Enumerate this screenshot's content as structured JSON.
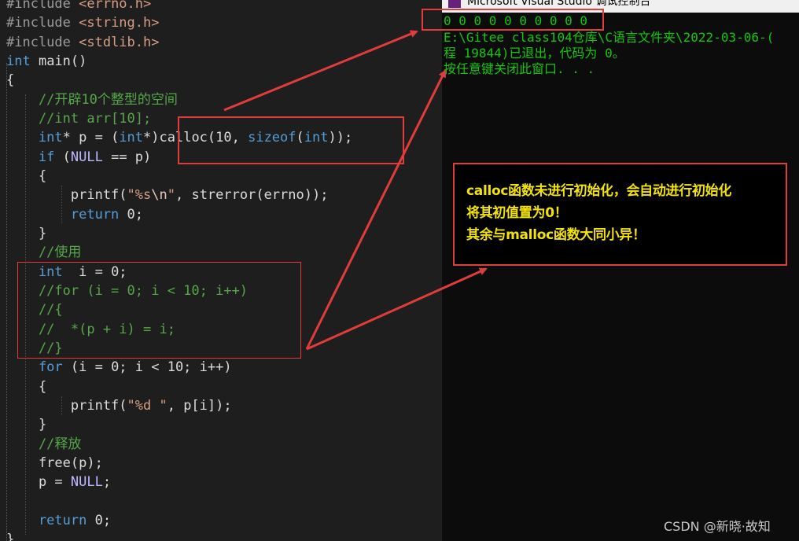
{
  "editor": {
    "lines": [
      [
        [
          "pp",
          "#include "
        ],
        [
          "st",
          "<errno.h>"
        ]
      ],
      [
        [
          "pp",
          "#include "
        ],
        [
          "st",
          "<string.h>"
        ]
      ],
      [
        [
          "pp",
          "#include "
        ],
        [
          "st",
          "<stdlib.h>"
        ]
      ],
      [
        [
          "kw",
          "int"
        ],
        [
          "pl",
          " main()"
        ]
      ],
      [
        [
          "pl",
          "{"
        ]
      ],
      [
        [
          "cm",
          "    //开辟10个整型的空间"
        ]
      ],
      [
        [
          "cm",
          "    //int arr[10];"
        ]
      ],
      [
        [
          "kw",
          "    int"
        ],
        [
          "pl",
          "* p = ("
        ],
        [
          "kw",
          "int"
        ],
        [
          "pl",
          "*)calloc(10, "
        ],
        [
          "kw",
          "sizeof"
        ],
        [
          "pl",
          "("
        ],
        [
          "kw",
          "int"
        ],
        [
          "pl",
          "));"
        ]
      ],
      [
        [
          "kw",
          "    if"
        ],
        [
          "pl",
          " ("
        ],
        [
          "mc",
          "NULL"
        ],
        [
          "pl",
          " == p)"
        ]
      ],
      [
        [
          "pl",
          "    {"
        ]
      ],
      [
        [
          "pl",
          "        printf("
        ],
        [
          "st",
          "\"%s"
        ],
        [
          "ex",
          "\\n"
        ],
        [
          "st",
          "\""
        ],
        [
          "pl",
          ", strerror(errno));"
        ]
      ],
      [
        [
          "kw",
          "        return"
        ],
        [
          "pl",
          " 0;"
        ]
      ],
      [
        [
          "pl",
          "    }"
        ]
      ],
      [
        [
          "cm",
          "    //使用"
        ]
      ],
      [
        [
          "kw",
          "    int"
        ],
        [
          "pl",
          "  i = 0;"
        ]
      ],
      [
        [
          "cm",
          "    //for (i = 0; i < 10; i++)"
        ]
      ],
      [
        [
          "cm",
          "    //{"
        ]
      ],
      [
        [
          "cm",
          "    //  *(p + i) = i;"
        ]
      ],
      [
        [
          "cm",
          "    //}"
        ]
      ],
      [
        [
          "kw",
          "    for"
        ],
        [
          "pl",
          " (i = 0; i < 10; i++)"
        ]
      ],
      [
        [
          "pl",
          "    {"
        ]
      ],
      [
        [
          "pl",
          "        printf("
        ],
        [
          "st",
          "\"%d \""
        ],
        [
          "pl",
          ", p[i]);"
        ]
      ],
      [
        [
          "pl",
          "    }"
        ]
      ],
      [
        [
          "cm",
          "    //释放"
        ]
      ],
      [
        [
          "pl",
          "    free(p);"
        ]
      ],
      [
        [
          "pl",
          "    p = "
        ],
        [
          "mc",
          "NULL"
        ],
        [
          "pl",
          ";"
        ]
      ],
      [
        [
          "pl",
          ""
        ]
      ],
      [
        [
          "kw",
          "    return"
        ],
        [
          "pl",
          " 0;"
        ]
      ],
      [
        [
          "pl",
          "}"
        ]
      ]
    ]
  },
  "console": {
    "title": "Microsoft Visual Studio 调试控制台",
    "lines": [
      "0 0 0 0 0 0 0 0 0 0",
      "E:\\Gitee class104仓库\\C语言文件夹\\2022-03-06-(",
      "程 19844)已退出，代码为 0。",
      "按任意键关闭此窗口. . ."
    ]
  },
  "note": {
    "lines": [
      "calloc函数未进行初始化，会自动进行初始化",
      "将其初值置为0！",
      "其余与malloc函数大同小异！"
    ]
  },
  "colors": {
    "annotation_red": "#e03c3c",
    "note_text": "#f4e30a",
    "console_green": "#16c60c"
  },
  "watermark": "CSDN @新晓·故知"
}
